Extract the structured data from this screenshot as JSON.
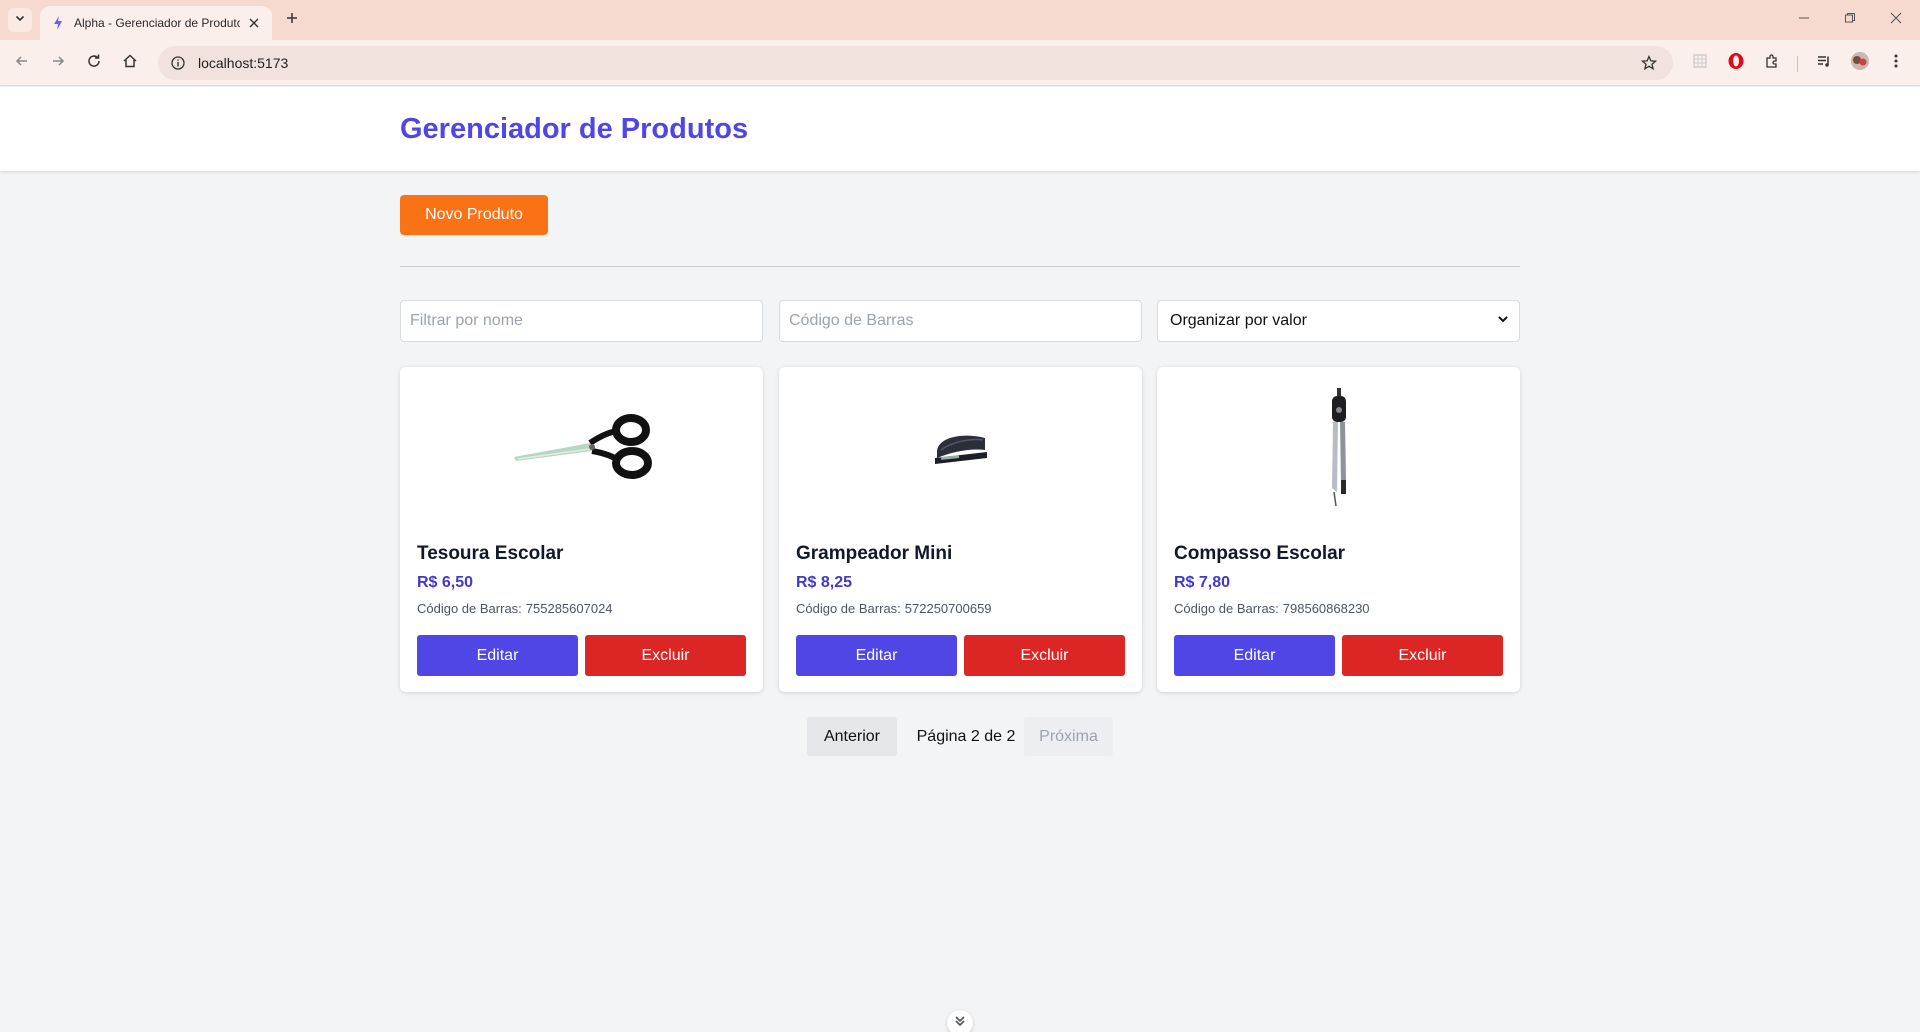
{
  "browser": {
    "tab_title": "Alpha - Gerenciador de Produtos",
    "url": "localhost:5173"
  },
  "app": {
    "title": "Gerenciador de Produtos",
    "new_product_label": "Novo Produto"
  },
  "filters": {
    "name_placeholder": "Filtrar por nome",
    "barcode_placeholder": "Código de Barras",
    "sort_selected": "Organizar por valor"
  },
  "products": [
    {
      "name": "Tesoura Escolar",
      "price": "R$ 6,50",
      "barcode_label": "Código de Barras:",
      "barcode": "755285607024",
      "edit_label": "Editar",
      "delete_label": "Excluir",
      "image_icon": "scissors-icon"
    },
    {
      "name": "Grampeador Mini",
      "price": "R$ 8,25",
      "barcode_label": "Código de Barras:",
      "barcode": "572250700659",
      "edit_label": "Editar",
      "delete_label": "Excluir",
      "image_icon": "stapler-icon"
    },
    {
      "name": "Compasso Escolar",
      "price": "R$ 7,80",
      "barcode_label": "Código de Barras:",
      "barcode": "798560868230",
      "edit_label": "Editar",
      "delete_label": "Excluir",
      "image_icon": "compass-icon"
    }
  ],
  "pagination": {
    "prev_label": "Anterior",
    "page_info": "Página 2 de 2",
    "next_label": "Próxima",
    "current_page": 2,
    "total_pages": 2
  },
  "colors": {
    "brand": "#4f46e5",
    "new_button": "#f97316",
    "edit_button": "#4f46e5",
    "delete_button": "#dc2626",
    "price": "#4338ca"
  }
}
